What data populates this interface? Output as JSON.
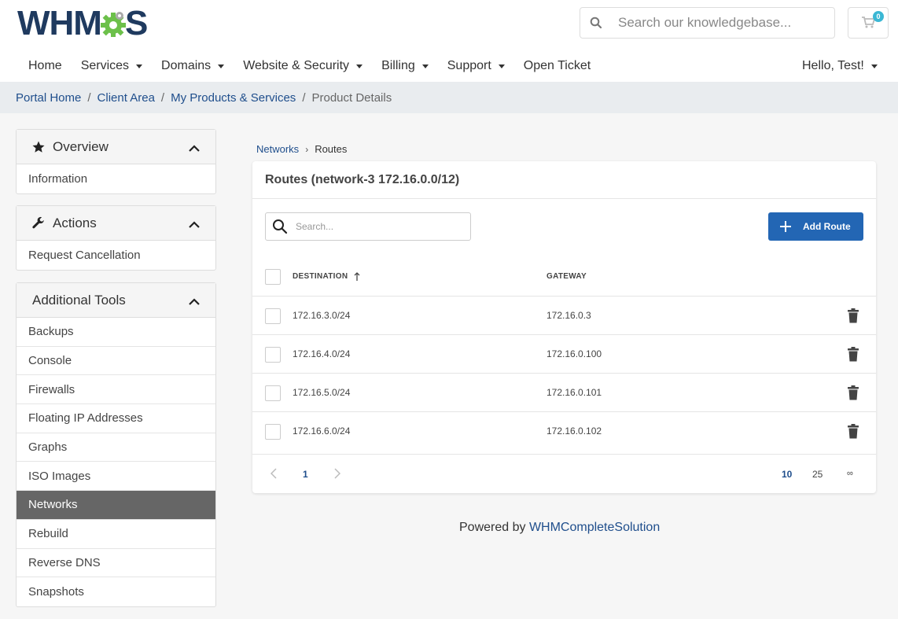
{
  "header": {
    "logo_text_left": "WHM",
    "logo_text_right": "S",
    "search_placeholder": "Search our knowledgebase...",
    "cart_count": "0"
  },
  "nav": {
    "items": [
      {
        "label": "Home",
        "dropdown": false
      },
      {
        "label": "Services",
        "dropdown": true
      },
      {
        "label": "Domains",
        "dropdown": true
      },
      {
        "label": "Website & Security",
        "dropdown": true
      },
      {
        "label": "Billing",
        "dropdown": true
      },
      {
        "label": "Support",
        "dropdown": true
      },
      {
        "label": "Open Ticket",
        "dropdown": false
      }
    ],
    "user_label": "Hello, Test!"
  },
  "breadcrumb": {
    "items": [
      "Portal Home",
      "Client Area",
      "My Products & Services"
    ],
    "current": "Product Details"
  },
  "sidebar": {
    "overview": {
      "title": "Overview",
      "items": [
        "Information"
      ]
    },
    "actions": {
      "title": "Actions",
      "items": [
        "Request Cancellation"
      ]
    },
    "tools": {
      "title": "Additional Tools",
      "items": [
        "Backups",
        "Console",
        "Firewalls",
        "Floating IP Addresses",
        "Graphs",
        "ISO Images",
        "Networks",
        "Rebuild",
        "Reverse DNS",
        "Snapshots"
      ],
      "active": "Networks"
    }
  },
  "main": {
    "subcrumb_link": "Networks",
    "subcrumb_current": "Routes",
    "card_title": "Routes (network-3 172.16.0.0/12)",
    "search_placeholder": "Search...",
    "add_button": "Add Route",
    "columns": {
      "destination": "DESTINATION",
      "gateway": "GATEWAY"
    },
    "rows": [
      {
        "destination": "172.16.3.0/24",
        "gateway": "172.16.0.3"
      },
      {
        "destination": "172.16.4.0/24",
        "gateway": "172.16.0.100"
      },
      {
        "destination": "172.16.5.0/24",
        "gateway": "172.16.0.101"
      },
      {
        "destination": "172.16.6.0/24",
        "gateway": "172.16.0.102"
      }
    ],
    "pager": {
      "current_page": "1",
      "sizes": [
        "10",
        "25",
        "∞"
      ],
      "active_size": "10"
    }
  },
  "footer": {
    "prefix": "Powered by ",
    "link": "WHMCompleteSolution"
  },
  "colors": {
    "brand_blue": "#1f3a5f",
    "link": "#1f4e8c",
    "button": "#2366b4",
    "badge": "#3bb7d4",
    "active_item": "#666666"
  }
}
